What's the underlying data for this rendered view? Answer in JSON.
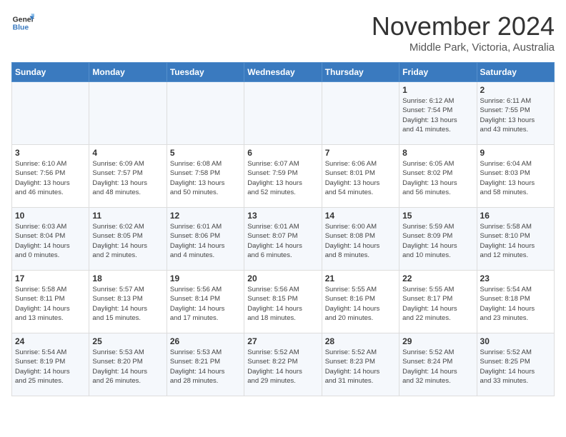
{
  "logo": {
    "line1": "General",
    "line2": "Blue"
  },
  "title": "November 2024",
  "subtitle": "Middle Park, Victoria, Australia",
  "days_of_week": [
    "Sunday",
    "Monday",
    "Tuesday",
    "Wednesday",
    "Thursday",
    "Friday",
    "Saturday"
  ],
  "weeks": [
    [
      {
        "day": "",
        "info": ""
      },
      {
        "day": "",
        "info": ""
      },
      {
        "day": "",
        "info": ""
      },
      {
        "day": "",
        "info": ""
      },
      {
        "day": "",
        "info": ""
      },
      {
        "day": "1",
        "info": "Sunrise: 6:12 AM\nSunset: 7:54 PM\nDaylight: 13 hours\nand 41 minutes."
      },
      {
        "day": "2",
        "info": "Sunrise: 6:11 AM\nSunset: 7:55 PM\nDaylight: 13 hours\nand 43 minutes."
      }
    ],
    [
      {
        "day": "3",
        "info": "Sunrise: 6:10 AM\nSunset: 7:56 PM\nDaylight: 13 hours\nand 46 minutes."
      },
      {
        "day": "4",
        "info": "Sunrise: 6:09 AM\nSunset: 7:57 PM\nDaylight: 13 hours\nand 48 minutes."
      },
      {
        "day": "5",
        "info": "Sunrise: 6:08 AM\nSunset: 7:58 PM\nDaylight: 13 hours\nand 50 minutes."
      },
      {
        "day": "6",
        "info": "Sunrise: 6:07 AM\nSunset: 7:59 PM\nDaylight: 13 hours\nand 52 minutes."
      },
      {
        "day": "7",
        "info": "Sunrise: 6:06 AM\nSunset: 8:01 PM\nDaylight: 13 hours\nand 54 minutes."
      },
      {
        "day": "8",
        "info": "Sunrise: 6:05 AM\nSunset: 8:02 PM\nDaylight: 13 hours\nand 56 minutes."
      },
      {
        "day": "9",
        "info": "Sunrise: 6:04 AM\nSunset: 8:03 PM\nDaylight: 13 hours\nand 58 minutes."
      }
    ],
    [
      {
        "day": "10",
        "info": "Sunrise: 6:03 AM\nSunset: 8:04 PM\nDaylight: 14 hours\nand 0 minutes."
      },
      {
        "day": "11",
        "info": "Sunrise: 6:02 AM\nSunset: 8:05 PM\nDaylight: 14 hours\nand 2 minutes."
      },
      {
        "day": "12",
        "info": "Sunrise: 6:01 AM\nSunset: 8:06 PM\nDaylight: 14 hours\nand 4 minutes."
      },
      {
        "day": "13",
        "info": "Sunrise: 6:01 AM\nSunset: 8:07 PM\nDaylight: 14 hours\nand 6 minutes."
      },
      {
        "day": "14",
        "info": "Sunrise: 6:00 AM\nSunset: 8:08 PM\nDaylight: 14 hours\nand 8 minutes."
      },
      {
        "day": "15",
        "info": "Sunrise: 5:59 AM\nSunset: 8:09 PM\nDaylight: 14 hours\nand 10 minutes."
      },
      {
        "day": "16",
        "info": "Sunrise: 5:58 AM\nSunset: 8:10 PM\nDaylight: 14 hours\nand 12 minutes."
      }
    ],
    [
      {
        "day": "17",
        "info": "Sunrise: 5:58 AM\nSunset: 8:11 PM\nDaylight: 14 hours\nand 13 minutes."
      },
      {
        "day": "18",
        "info": "Sunrise: 5:57 AM\nSunset: 8:13 PM\nDaylight: 14 hours\nand 15 minutes."
      },
      {
        "day": "19",
        "info": "Sunrise: 5:56 AM\nSunset: 8:14 PM\nDaylight: 14 hours\nand 17 minutes."
      },
      {
        "day": "20",
        "info": "Sunrise: 5:56 AM\nSunset: 8:15 PM\nDaylight: 14 hours\nand 18 minutes."
      },
      {
        "day": "21",
        "info": "Sunrise: 5:55 AM\nSunset: 8:16 PM\nDaylight: 14 hours\nand 20 minutes."
      },
      {
        "day": "22",
        "info": "Sunrise: 5:55 AM\nSunset: 8:17 PM\nDaylight: 14 hours\nand 22 minutes."
      },
      {
        "day": "23",
        "info": "Sunrise: 5:54 AM\nSunset: 8:18 PM\nDaylight: 14 hours\nand 23 minutes."
      }
    ],
    [
      {
        "day": "24",
        "info": "Sunrise: 5:54 AM\nSunset: 8:19 PM\nDaylight: 14 hours\nand 25 minutes."
      },
      {
        "day": "25",
        "info": "Sunrise: 5:53 AM\nSunset: 8:20 PM\nDaylight: 14 hours\nand 26 minutes."
      },
      {
        "day": "26",
        "info": "Sunrise: 5:53 AM\nSunset: 8:21 PM\nDaylight: 14 hours\nand 28 minutes."
      },
      {
        "day": "27",
        "info": "Sunrise: 5:52 AM\nSunset: 8:22 PM\nDaylight: 14 hours\nand 29 minutes."
      },
      {
        "day": "28",
        "info": "Sunrise: 5:52 AM\nSunset: 8:23 PM\nDaylight: 14 hours\nand 31 minutes."
      },
      {
        "day": "29",
        "info": "Sunrise: 5:52 AM\nSunset: 8:24 PM\nDaylight: 14 hours\nand 32 minutes."
      },
      {
        "day": "30",
        "info": "Sunrise: 5:52 AM\nSunset: 8:25 PM\nDaylight: 14 hours\nand 33 minutes."
      }
    ]
  ]
}
